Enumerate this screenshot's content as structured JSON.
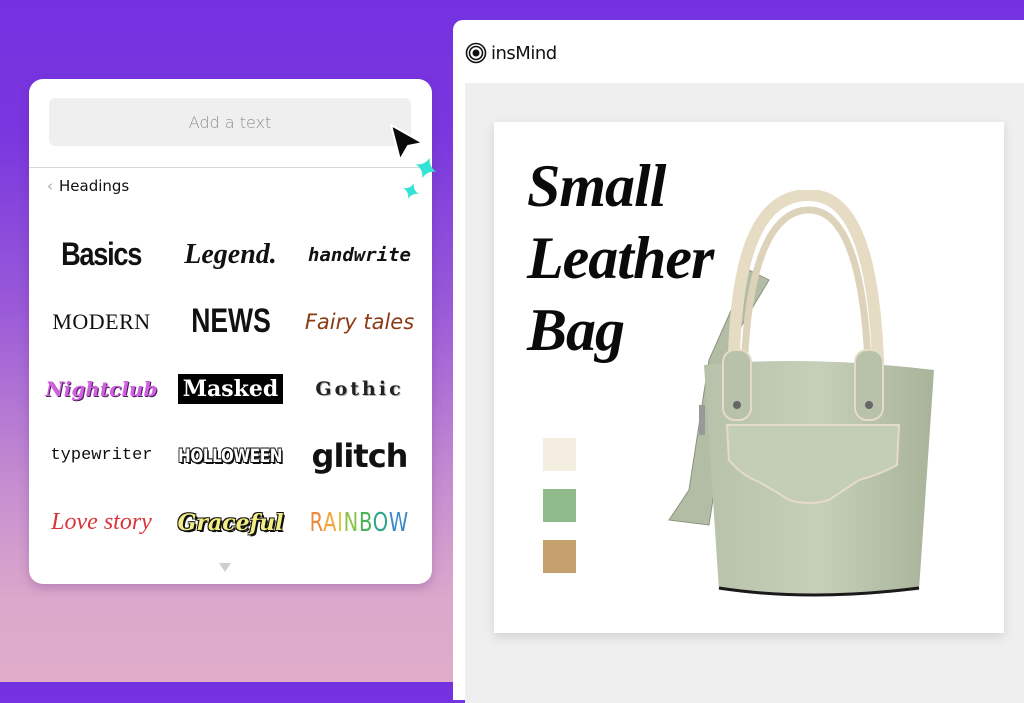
{
  "left_panel": {
    "add_text_label": "Add a text",
    "section_title": "Headings",
    "back_icon": "chevron-left-icon",
    "styles": [
      {
        "label": "Basics",
        "id": "basics"
      },
      {
        "label": "Legend.",
        "id": "legend"
      },
      {
        "label": "handwrite",
        "id": "handwrite"
      },
      {
        "label": "MODERN",
        "id": "modern"
      },
      {
        "label": "NEWS",
        "id": "news"
      },
      {
        "label": "Fairy tales",
        "id": "fairy"
      },
      {
        "label": "Nightclub",
        "id": "night"
      },
      {
        "label": "Masked",
        "id": "masked"
      },
      {
        "label": "Gothic",
        "id": "gothic"
      },
      {
        "label": "typewriter",
        "id": "type"
      },
      {
        "label": "HOLLOWEEN",
        "id": "hollo"
      },
      {
        "label": "glitch",
        "id": "glitch"
      },
      {
        "label": "Love story",
        "id": "love"
      },
      {
        "label": "Graceful",
        "id": "grace"
      },
      {
        "label": "RAINBOW",
        "id": "rainbow"
      }
    ],
    "rainbow_colors": [
      "#f0883c",
      "#f2a43a",
      "#e4c53a",
      "#8cc24a",
      "#4cb25a",
      "#2fa58a",
      "#3a8ac8"
    ],
    "more_icon": "triangle-down-icon"
  },
  "editor": {
    "brand_name": "insMind",
    "headline": [
      "Small",
      "Leather",
      "Bag"
    ],
    "swatches": [
      {
        "name": "cream",
        "color": "#f4eee0"
      },
      {
        "name": "sage-green",
        "color": "#8fbb8a"
      },
      {
        "name": "tan",
        "color": "#c4a06c"
      }
    ],
    "product": "green leather bucket bag"
  },
  "colors": {
    "accent_sparkle": "#34e3d6",
    "background_top": "#7431e0",
    "background_bottom": "#e0acca"
  }
}
